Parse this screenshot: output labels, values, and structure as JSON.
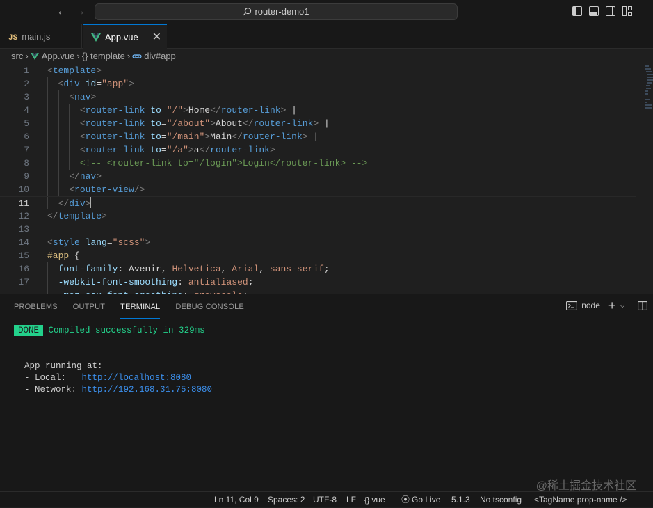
{
  "titlebar": {
    "search_text": "router-demo1"
  },
  "tabs": [
    {
      "badge": "JS",
      "label": "main.js"
    },
    {
      "label": "App.vue",
      "close": "✕"
    }
  ],
  "breadcrumb": {
    "folder": "src",
    "file": "App.vue",
    "section": "{} template",
    "element": "div#app"
  },
  "editor": {
    "line_numbers": [
      "1",
      "2",
      "3",
      "4",
      "5",
      "6",
      "7",
      "8",
      "9",
      "10",
      "11",
      "12",
      "13",
      "14",
      "15",
      "16",
      "17"
    ]
  },
  "panel": {
    "tabs": [
      "PROBLEMS",
      "OUTPUT",
      "TERMINAL",
      "DEBUG CONSOLE"
    ],
    "shell": "node",
    "terminal": {
      "done_badge": "DONE",
      "compiled": "Compiled successfully in 329ms",
      "app_running": "App running at:",
      "local_label": "- Local:   ",
      "local_url": "http://localhost:8080",
      "network_label": "- Network: ",
      "network_url": "http://192.168.31.75:8080"
    }
  },
  "statusbar": {
    "position": "Ln 11, Col 9",
    "spaces": "Spaces: 2",
    "encoding": "UTF-8",
    "eol": "LF",
    "language": "vue",
    "golive": "Go Live",
    "version": "5.1.3",
    "tsconfig": "No tsconfig",
    "tagname": "<TagName prop-name />"
  },
  "watermark": "@稀土掘金技术社区",
  "colors": {
    "accent": "#0078d4",
    "done": "#23d18b",
    "link": "#3b8eea"
  }
}
